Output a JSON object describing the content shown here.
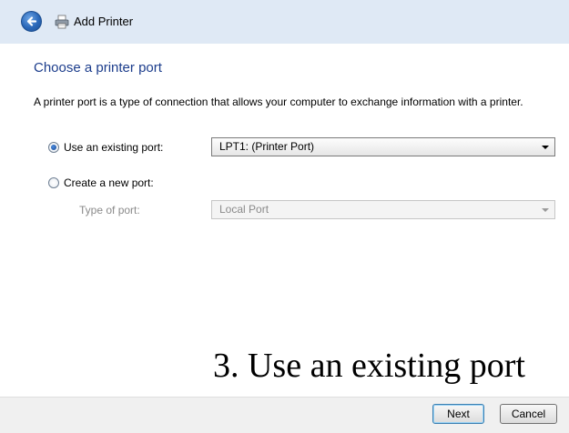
{
  "window": {
    "title": "Add Printer"
  },
  "page": {
    "heading": "Choose a printer port",
    "description": "A printer port is a type of connection that allows your computer to exchange information with a printer."
  },
  "options": {
    "existing": {
      "label": "Use an existing port:",
      "selected": true,
      "value": "LPT1: (Printer Port)"
    },
    "new": {
      "label": "Create a new port:",
      "selected": false,
      "type_label": "Type of port:",
      "type_value": "Local Port"
    }
  },
  "caption": "3. Use an existing port",
  "buttons": {
    "next": "Next",
    "cancel": "Cancel"
  },
  "colors": {
    "titlebar": "#dfe9f5",
    "heading": "#1c3d8c",
    "footer": "#f0f0f0"
  }
}
